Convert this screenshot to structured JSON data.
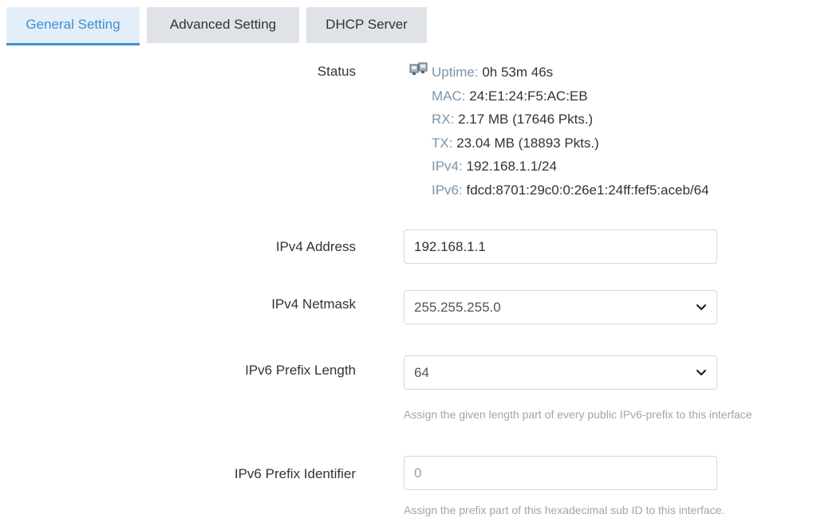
{
  "tabs": [
    {
      "label": "General Setting",
      "active": true
    },
    {
      "label": "Advanced Setting",
      "active": false
    },
    {
      "label": "DHCP Server",
      "active": false
    }
  ],
  "status": {
    "label": "Status",
    "icon": "network-port-icon",
    "uptime_key": "Uptime:",
    "uptime_val": "0h 53m 46s",
    "mac_key": "MAC:",
    "mac_val": "24:E1:24:F5:AC:EB",
    "rx_key": "RX:",
    "rx_val": "2.17 MB (17646 Pkts.)",
    "tx_key": "TX:",
    "tx_val": "23.04 MB (18893 Pkts.)",
    "ipv4_key": "IPv4:",
    "ipv4_val": "192.168.1.1/24",
    "ipv6_key": "IPv6:",
    "ipv6_val": "fdcd:8701:29c0:0:26e1:24ff:fef5:aceb/64"
  },
  "form": {
    "ipv4_address": {
      "label": "IPv4 Address",
      "value": "192.168.1.1"
    },
    "ipv4_netmask": {
      "label": "IPv4 Netmask",
      "value": "255.255.255.0"
    },
    "ipv6_prefix_length": {
      "label": "IPv6 Prefix Length",
      "value": "64",
      "hint": "Assign the given length part of every public IPv6-prefix to this interface"
    },
    "ipv6_prefix_identifier": {
      "label": "IPv6 Prefix Identifier",
      "value": "0",
      "hint": "Assign the prefix part of this hexadecimal sub ID to this interface."
    }
  },
  "colors": {
    "accent": "#3f8fd2",
    "tab_inactive_bg": "#dfe3e7",
    "status_key": "#7c94a8"
  }
}
